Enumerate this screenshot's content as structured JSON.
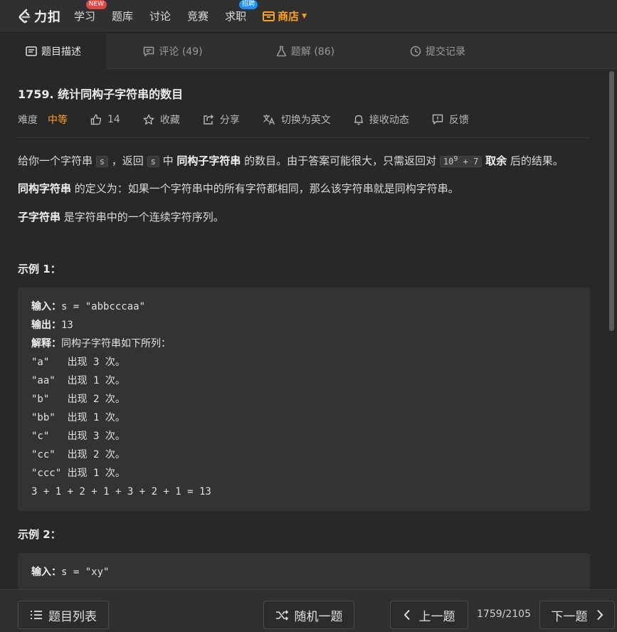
{
  "nav": {
    "logo_text": "力扣",
    "items": [
      {
        "label": "学习",
        "badge": "NEW"
      },
      {
        "label": "题库"
      },
      {
        "label": "讨论"
      },
      {
        "label": "竞赛"
      },
      {
        "label": "求职",
        "badge": "招聘"
      }
    ],
    "shop": "商店"
  },
  "tabs": [
    {
      "label": "题目描述",
      "active": true
    },
    {
      "label": "评论 (49)"
    },
    {
      "label": "题解 (86)"
    },
    {
      "label": "提交记录"
    }
  ],
  "question": {
    "title": "1759. 统计同构子字符串的数目",
    "difficulty_label": "难度",
    "difficulty": "中等",
    "likes": "14",
    "favorite": "收藏",
    "share": "分享",
    "switch_lang": "切换为英文",
    "notify": "接收动态",
    "feedback": "反馈"
  },
  "description": {
    "p1": {
      "a": "给你一个字符串 ",
      "code1": "s",
      "b": " ，返回 ",
      "code2": "s",
      "c": " 中 ",
      "bold1": "同构子字符串",
      "d": " 的数目。由于答案可能很大，只需返回对 ",
      "code3_base": "10",
      "code3_exp": "9",
      "code3_rest": " + 7",
      "e": " ",
      "bold2": "取余",
      "f": " 后的结果。"
    },
    "p2": {
      "bold": "同构字符串",
      "text": " 的定义为：如果一个字符串中的所有字符都相同，那么该字符串就是同构字符串。"
    },
    "p3": {
      "bold": "子字符串",
      "text": " 是字符串中的一个连续字符序列。"
    }
  },
  "example1": {
    "title": "示例 1：",
    "input_label": "输入：",
    "input_value": "s = \"abbcccaa\"",
    "output_label": "输出：",
    "output_value": "13",
    "explain_label": "解释：",
    "explain_value": "同构子字符串如下所列：",
    "lines": [
      "\"a\"   出现 3 次。",
      "\"aa\"  出现 1 次。",
      "\"b\"   出现 2 次。",
      "\"bb\"  出现 1 次。",
      "\"c\"   出现 3 次。",
      "\"cc\"  出现 2 次。",
      "\"ccc\" 出现 1 次。",
      "3 + 1 + 2 + 1 + 3 + 2 + 1 = 13"
    ]
  },
  "example2": {
    "title": "示例 2：",
    "input_label": "输入：",
    "input_value": "s = \"xy\""
  },
  "footer": {
    "list": "题目列表",
    "random": "随机一题",
    "prev": "上一题",
    "page": "1759/2105",
    "next": "下一题"
  },
  "colors": {
    "accent": "#ffa116",
    "background": "#282828"
  }
}
